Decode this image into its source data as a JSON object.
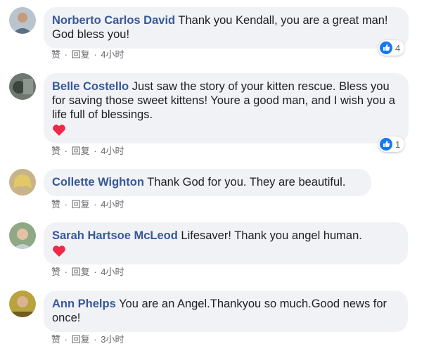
{
  "ui": {
    "like_label": "赞",
    "reply_label": "回复",
    "separator": "·"
  },
  "colors": {
    "author": "#385898",
    "bubble": "#f0f2f5",
    "meta": "#65676b",
    "like_blue": "#1877f2",
    "heart_red": "#f02849"
  },
  "comments": [
    {
      "author": "Norberto Carlos David",
      "text": "Thank you Kendall, you are a great man! God bless you!",
      "time": "4小时",
      "reaction_icon": "like-icon",
      "reaction_count": "4"
    },
    {
      "author": "Belle Costello",
      "text": "Just saw the story of your kitten rescue. Bless you for saving those sweet kittens! Youre a good man, and I wish you a life full of blessings.",
      "emoji": "heart-emoji",
      "time": "4小时",
      "reaction_icon": "like-icon",
      "reaction_count": "1"
    },
    {
      "author": "Collette Wighton",
      "text": "Thank God for you. They are beautiful.",
      "time": "4小时"
    },
    {
      "author": "Sarah Hartsoe McLeod",
      "text": "Lifesaver! Thank you angel human.",
      "emoji": "heart-emoji",
      "time": "4小时"
    },
    {
      "author": "Ann Phelps",
      "text": "You are an Angel.Thankyou so much.Good news for once!",
      "time": "3小时"
    }
  ]
}
